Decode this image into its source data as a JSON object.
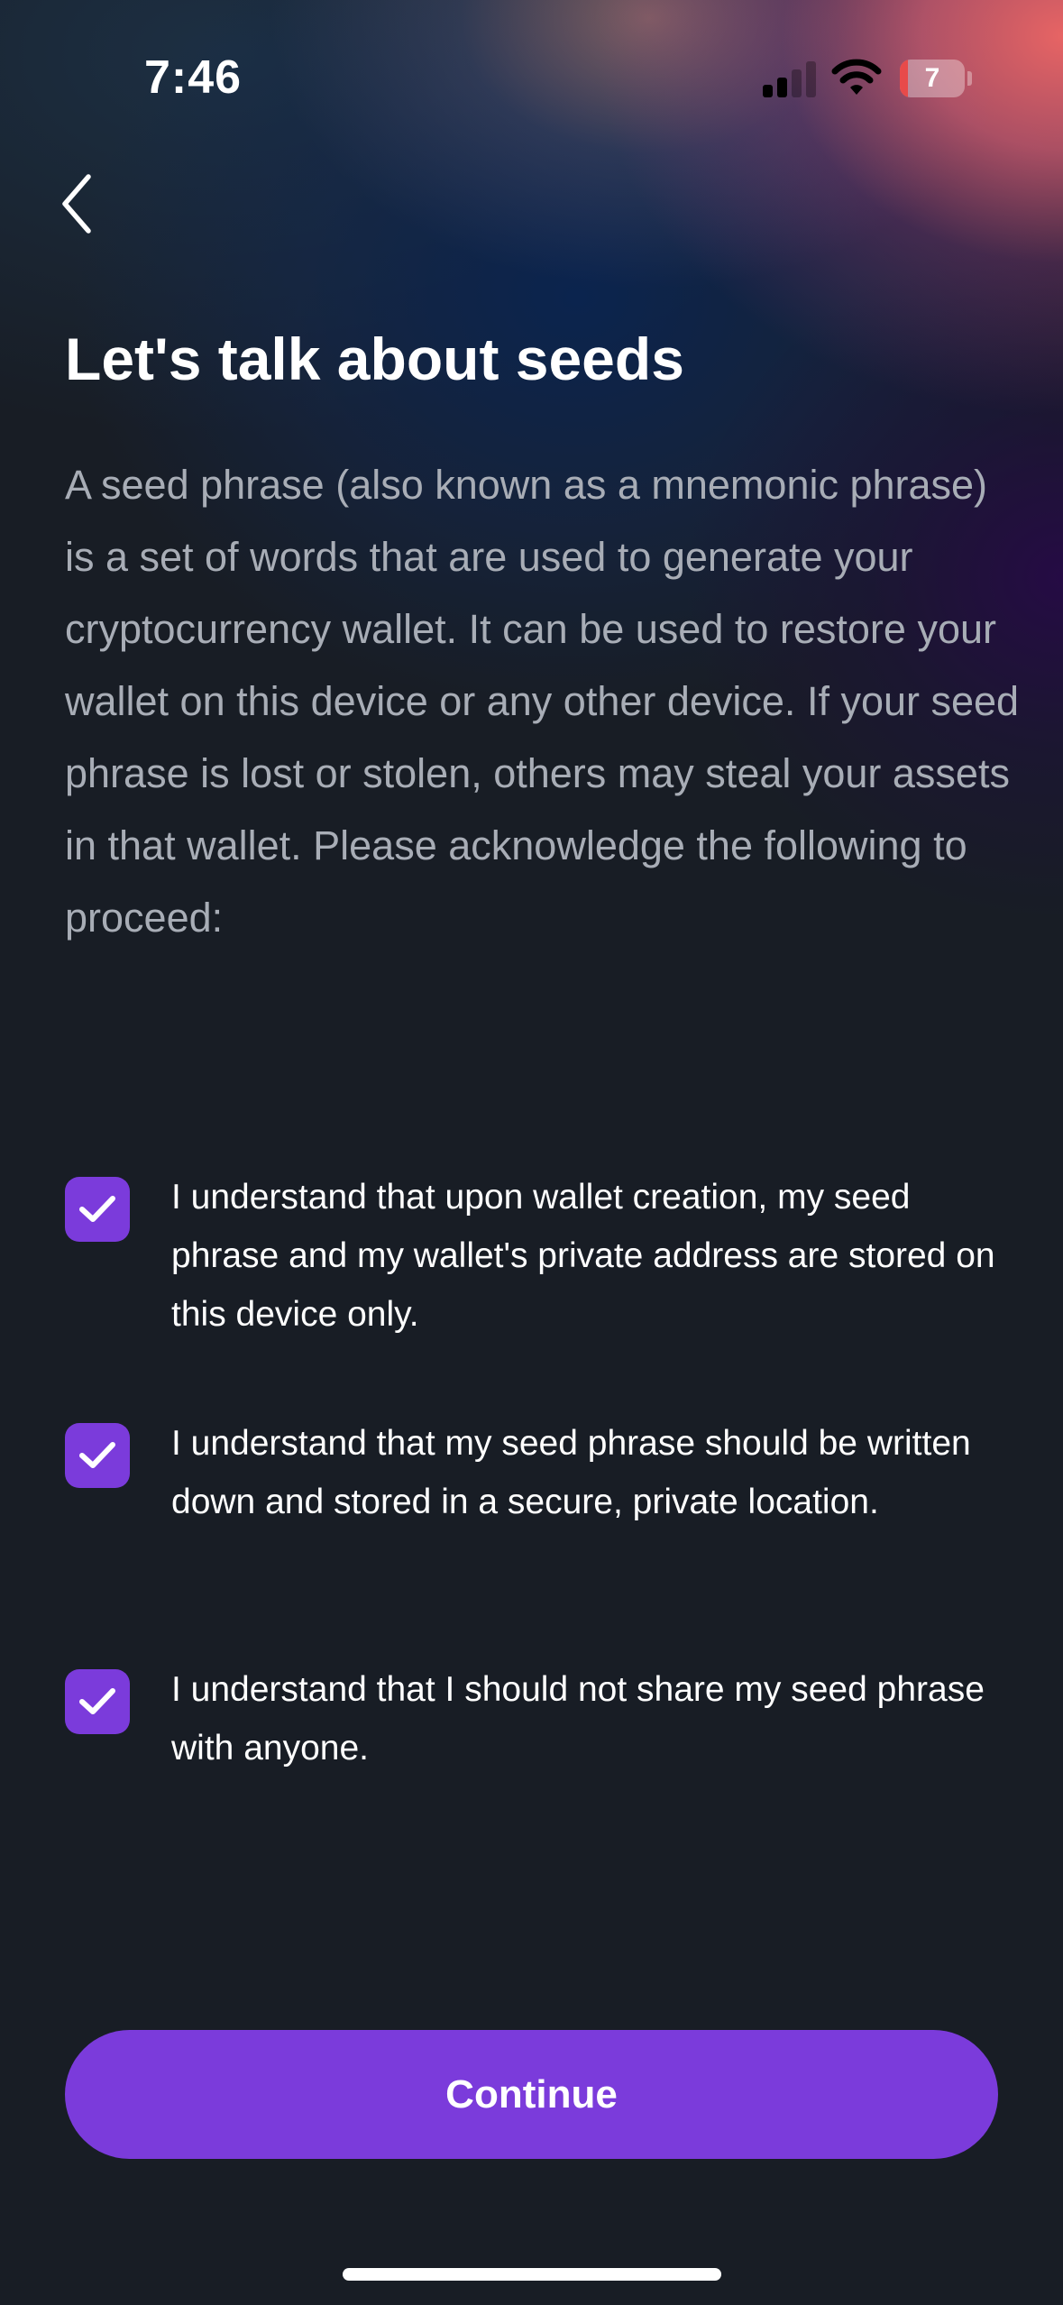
{
  "status_bar": {
    "time": "7:46",
    "battery_level": "7",
    "battery_fraction": 0.07,
    "signal_bars_active": 2,
    "signal_bars_total": 4,
    "icons": [
      "cellular-signal-icon",
      "wifi-icon",
      "battery-icon"
    ]
  },
  "nav": {
    "back_icon": "chevron-left-icon"
  },
  "page": {
    "title": "Let's talk about seeds",
    "description": "A seed phrase (also known as a mnemonic phrase) is a set of words that are used to generate your cryptocurrency wallet. It can be used to restore your wallet on this device or any other device. If your seed phrase is lost or stolen, others may steal your assets in that wallet. Please acknowledge the following to proceed:"
  },
  "acknowledgements": [
    {
      "text": "I understand that upon wallet creation, my seed phrase and my wallet's private address are stored on this device only.",
      "checked": true
    },
    {
      "text": "I understand that my seed phrase should be written down and stored in a secure, private location.",
      "checked": true
    },
    {
      "text": "I understand that I should not share my seed phrase with anyone.",
      "checked": true
    }
  ],
  "footer": {
    "continue_label": "Continue"
  },
  "colors": {
    "background": "#181d25",
    "accent": "#7b3bdb",
    "text_primary": "#ffffff",
    "text_secondary": "#a8adb6",
    "battery_low": "#e84a4a"
  }
}
